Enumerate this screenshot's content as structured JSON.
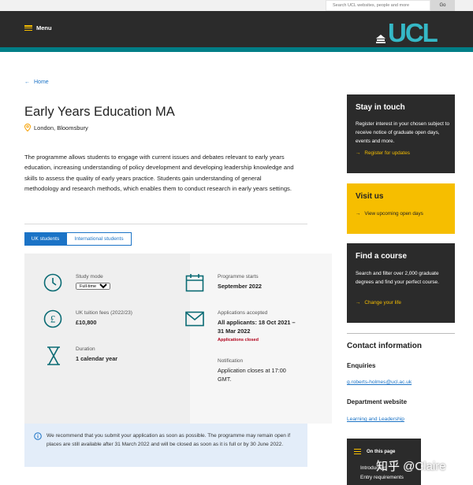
{
  "search": {
    "placeholder": "Search UCL websites, people and more",
    "go_label": "Go"
  },
  "header": {
    "menu_label": "Menu",
    "logo_text": "UCL"
  },
  "breadcrumb": {
    "home_label": "Home"
  },
  "programme": {
    "title": "Early Years Education MA",
    "location": "London, Bloomsbury",
    "intro": "The programme allows students to engage with current issues and debates relevant to early years education, increasing understanding of policy development and developing leadership knowledge and skills to assess the quality of early years practice. Students gain understanding of general methodology and research methods, which enables them to conduct research in early years settings."
  },
  "tabs": [
    {
      "label": "UK students",
      "active": true
    },
    {
      "label": "International students",
      "active": false
    }
  ],
  "key_info": {
    "study_mode_label": "Study mode",
    "study_mode_value": "Full-time",
    "fees_label": "UK tuition fees (2022/23)",
    "fees_value": "£10,800",
    "duration_label": "Duration",
    "duration_value": "1 calendar year",
    "starts_label": "Programme starts",
    "starts_value": "September 2022",
    "applications_label": "Applications accepted",
    "applications_value": "All applicants: 18 Oct 2021 – 31 Mar 2022",
    "applications_status": "Applications closed",
    "notification_label": "Notification",
    "notification_value": "Application closes at 17:00 GMT."
  },
  "notice": {
    "text": "We recommend that you submit your application as soon as possible. The programme may remain open if places are still available after 31 March 2022 and will be closed as soon as it is full or by 30 June 2022."
  },
  "sidebar": {
    "stay_title": "Stay in touch",
    "stay_text": "Register interest in your chosen subject to receive notice of graduate open days, events and more.",
    "stay_link": "Register for updates",
    "visit_title": "Visit us",
    "visit_link": "View upcoming open days",
    "find_title": "Find a course",
    "find_text": "Search and filter over 2,000 graduate degrees and find your perfect course.",
    "find_link": "Change your life",
    "contact_title": "Contact information",
    "enquiries_label": "Enquiries",
    "enquiries_email": "g.roberts-holmes@ucl.ac.uk",
    "dept_label": "Department website",
    "dept_link": "Learning and Leadership",
    "on_this_page_label": "On this page",
    "on_this_page_items": [
      "Introduction",
      "Entry requirements"
    ]
  },
  "watermark": "知乎 @Claire",
  "colors": {
    "accent_yellow": "#f6be00",
    "link_blue": "#1b73c6",
    "dark": "#2b2b2b",
    "teal": "#007e87"
  }
}
